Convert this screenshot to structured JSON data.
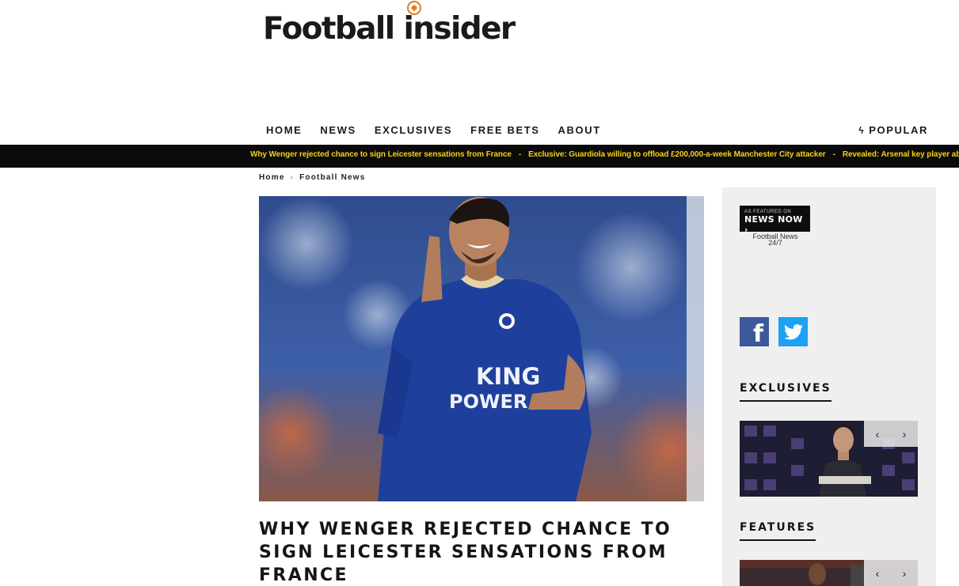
{
  "site": {
    "logo_text": "Football insider"
  },
  "nav": {
    "items": [
      "HOME",
      "NEWS",
      "EXCLUSIVES",
      "FREE BETS",
      "ABOUT"
    ],
    "popular": "POPULAR"
  },
  "ticker": {
    "headlines": [
      "Why Wenger rejected chance to sign Leicester sensations from France",
      "Exclusive: Guardiola willing to offload £200,000-a-week Manchester City attacker",
      "Revealed: Arsenal key player abs"
    ],
    "separator": "-"
  },
  "breadcrumb": {
    "home": "Home",
    "separator": "›",
    "current": "Football News"
  },
  "hero": {
    "shirt_line1": "KING",
    "shirt_line2": "POWER"
  },
  "article": {
    "headline": "WHY WENGER REJECTED CHANCE TO SIGN LEICESTER SENSATIONS FROM FRANCE"
  },
  "sidebar": {
    "newsnow": {
      "small": "AS FEATURED ON",
      "big": "NEWS NOW",
      "caption_line1": "Football News",
      "caption_line2": "24/7"
    },
    "social": {
      "facebook": "f",
      "twitter": "twitter"
    },
    "exclusives_title": "EXCLUSIVES",
    "features_title": "FEATURES",
    "prev": "‹",
    "next": "›"
  },
  "colors": {
    "ticker_bg": "#0b0b0b",
    "ticker_text": "#f3d21b",
    "facebook": "#3b5998",
    "twitter": "#1da1f2",
    "accent_orange": "#e07b1f"
  }
}
